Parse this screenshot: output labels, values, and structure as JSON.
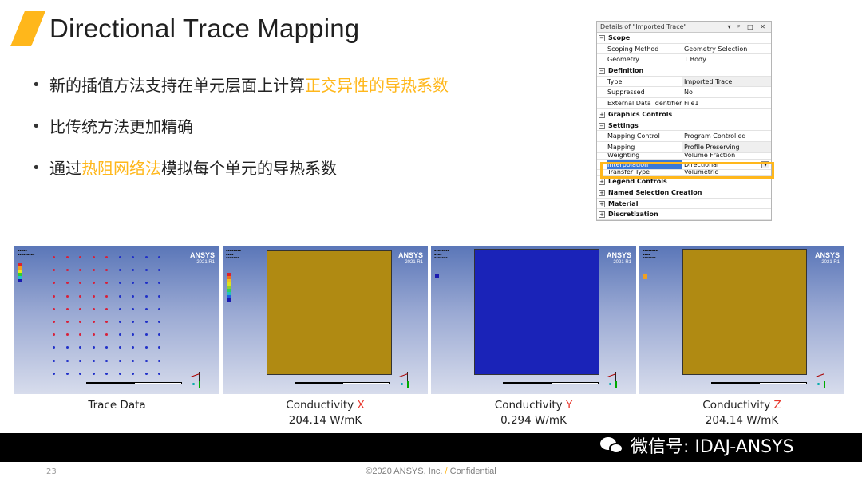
{
  "slide": {
    "title": "Directional Trace Mapping",
    "bullets": [
      {
        "pre": "新的插值方法支持在单元层面上计算",
        "hl": "正交异性的导热系数",
        "post": ""
      },
      {
        "pre": "比传统方法更加精确",
        "hl": "",
        "post": ""
      },
      {
        "pre": "通过",
        "hl": "热阻网络法",
        "post": "模拟每个单元的导热系数"
      }
    ],
    "accent_color": "#ffb71b"
  },
  "details_panel": {
    "header": "Details of \"Imported Trace\"",
    "header_controls": "▾ ᵖ □ ✕",
    "rows": [
      {
        "type": "section",
        "label": "Scope",
        "sign": "−"
      },
      {
        "type": "prop",
        "key": "Scoping Method",
        "value": "Geometry Selection"
      },
      {
        "type": "prop",
        "key": "Geometry",
        "value": "1 Body"
      },
      {
        "type": "section",
        "label": "Definition",
        "sign": "−"
      },
      {
        "type": "prop",
        "key": "Type",
        "value": "Imported Trace",
        "gray": true
      },
      {
        "type": "prop",
        "key": "Suppressed",
        "value": "No"
      },
      {
        "type": "prop",
        "key": "External Data Identifier",
        "value": "File1"
      },
      {
        "type": "section",
        "label": "Graphics Controls",
        "sign": "+"
      },
      {
        "type": "section",
        "label": "Settings",
        "sign": "−"
      },
      {
        "type": "prop",
        "key": "Mapping Control",
        "value": "Program Controlled"
      },
      {
        "type": "prop",
        "key": "Mapping",
        "value": "Profile Preserving",
        "gray": true
      },
      {
        "type": "cut",
        "key": "Weighting",
        "value": "Volume Fraction"
      },
      {
        "type": "selected",
        "key": "Interpolation",
        "value": "Directional"
      },
      {
        "type": "cut",
        "key": "Transfer Type",
        "value": "Volumetric"
      },
      {
        "type": "section",
        "label": "Legend Controls",
        "sign": "+"
      },
      {
        "type": "section",
        "label": "Named Selection Creation",
        "sign": "+"
      },
      {
        "type": "section",
        "label": "Material",
        "sign": "+"
      },
      {
        "type": "section",
        "label": "Discretization",
        "sign": "+"
      }
    ]
  },
  "thumbnails": [
    {
      "brand": "ANSYS",
      "version": "2021 R1",
      "caption_line1": "Trace Data",
      "axis": "",
      "caption_line2": ""
    },
    {
      "brand": "ANSYS",
      "version": "2021 R1",
      "caption_line1": "Conductivity ",
      "axis": "X",
      "caption_line2": "204.14 W/mK",
      "fill": "#b08a12"
    },
    {
      "brand": "ANSYS",
      "version": "2021 R1",
      "caption_line1": "Conductivity ",
      "axis": "Y",
      "caption_line2": "0.294 W/mK",
      "fill": "#1a23b8"
    },
    {
      "brand": "ANSYS",
      "version": "2021 R1",
      "caption_line1": "Conductivity ",
      "axis": "Z",
      "caption_line2": "204.14 W/mK",
      "fill": "#b08a12"
    }
  ],
  "footer": {
    "wechat_text": "微信号: IDAJ-ANSYS",
    "page_number": "23",
    "copyright": "©2020 ANSYS, Inc.",
    "slash": "/",
    "confidential": "Confidential"
  }
}
